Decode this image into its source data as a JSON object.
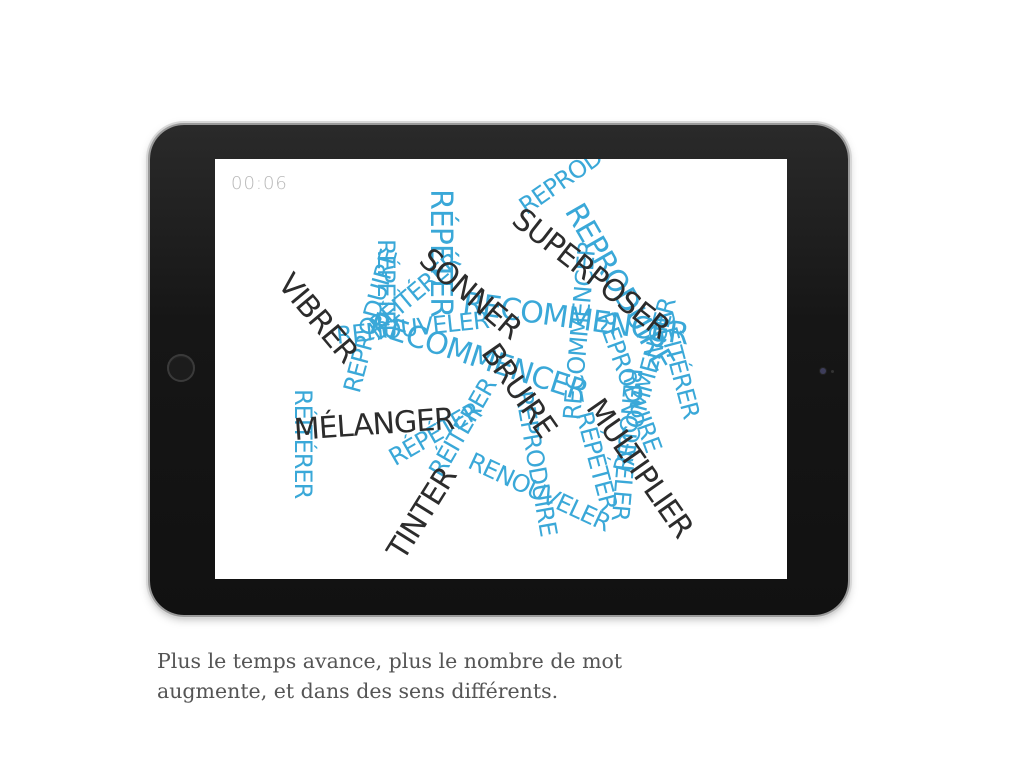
{
  "screen": {
    "timer": "00:06",
    "words_dark": [
      "VIBRER",
      "SONNER",
      "SUPERPOSER",
      "BRUIRE",
      "MULTIPLIER",
      "MÉLANGER",
      "TINTER"
    ],
    "words_blue": [
      "RÉPÉTER",
      "RECOMMENCER",
      "REPRODUIRE",
      "RÉPÉTER",
      "RECOMMENCER",
      "RENOUVELER",
      "REPRODUIRE",
      "RÉITÉRER",
      "RENOUVELER",
      "RÉITÉRER",
      "REPRODUIRE",
      "RENOUVELER",
      "RÉPÉTER",
      "RÉITÉRER",
      "REPRODUIRE",
      "RECOMMENCER",
      "RÉPÉTER",
      "RÉITÉRER",
      "REPRODUIRE",
      "RECOMMENCER"
    ]
  },
  "caption": {
    "line1": "Plus le temps avance, plus le nombre de mot",
    "line2": "augmente, et dans des sens différents."
  },
  "colors": {
    "dark_word": "#2c2c2c",
    "blue_word": "#3aa8d8",
    "tablet": "#161616",
    "caption": "#555555"
  }
}
